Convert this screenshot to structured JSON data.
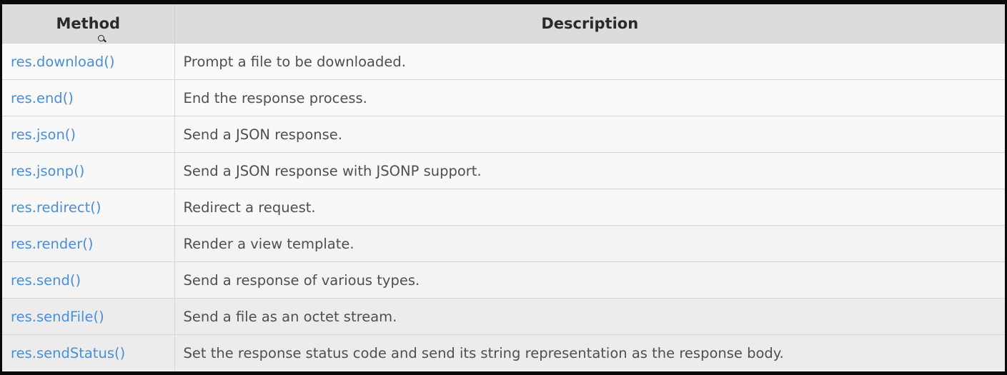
{
  "table": {
    "headers": [
      "Method",
      "Description"
    ],
    "rows": [
      {
        "method": "res.download()",
        "description": "Prompt a file to be downloaded."
      },
      {
        "method": "res.end()",
        "description": "End the response process."
      },
      {
        "method": "res.json()",
        "description": "Send a JSON response."
      },
      {
        "method": "res.jsonp()",
        "description": "Send a JSON response with JSONP support."
      },
      {
        "method": "res.redirect()",
        "description": "Redirect a request."
      },
      {
        "method": "res.render()",
        "description": "Render a view template."
      },
      {
        "method": "res.send()",
        "description": "Send a response of various types."
      },
      {
        "method": "res.sendFile()",
        "description": "Send a file as an octet stream."
      },
      {
        "method": "res.sendStatus()",
        "description": "Set the response status code and send its string representation as the response body."
      }
    ]
  },
  "colors": {
    "link": "#4a8fd6",
    "header_bg": "#dcdcdc"
  },
  "cursor_icon": "magnifier-cursor-icon"
}
